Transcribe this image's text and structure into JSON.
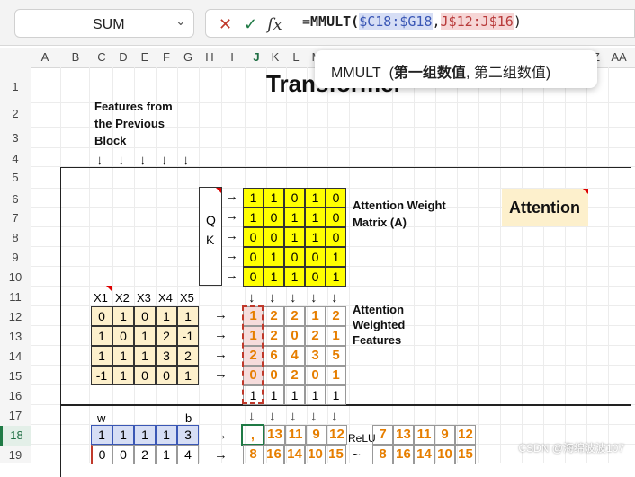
{
  "formula_bar": {
    "name_box": "SUM",
    "cancel_glyph": "✕",
    "enter_glyph": "✓",
    "fx_glyph": "fx",
    "formula_prefix": "=",
    "formula_func": "MMULT(",
    "ref1": "$C18:$G18",
    "comma": ",",
    "ref2": "J$12:J$16",
    "formula_close": ")"
  },
  "tooltip": {
    "func": "MMULT",
    "arg1": "第一组数值",
    "arg2": "第二组数值"
  },
  "columns": [
    "A",
    "B",
    "C",
    "D",
    "E",
    "F",
    "G",
    "H",
    "I",
    "J",
    "K",
    "L",
    "M",
    "N",
    "O",
    "P",
    "Q",
    "R",
    "S",
    "T",
    "U",
    "V",
    "W",
    "X",
    "Y",
    "Z",
    "AA"
  ],
  "rows": [
    "1",
    "2",
    "3",
    "4",
    "5",
    "6",
    "7",
    "8",
    "9",
    "10",
    "11",
    "12",
    "13",
    "14",
    "15",
    "16",
    "17",
    "18",
    "19"
  ],
  "sheet": {
    "title": "Transformer",
    "features_label": [
      "Features from",
      "the Previous",
      "Block"
    ],
    "attention_weight_label": [
      "Attention Weight",
      "Matrix (A)"
    ],
    "attention_badge": "Attention",
    "qk_labels": [
      "Q",
      "K"
    ],
    "x_headers": [
      "X1",
      "X2",
      "X3",
      "X4",
      "X5"
    ],
    "x_matrix": [
      [
        "0",
        "1",
        "0",
        "1",
        "1"
      ],
      [
        "1",
        "0",
        "1",
        "2",
        "-1"
      ],
      [
        "1",
        "1",
        "1",
        "3",
        "2"
      ],
      [
        "-1",
        "1",
        "0",
        "0",
        "1"
      ]
    ],
    "a_matrix": [
      [
        "1",
        "1",
        "0",
        "1",
        "0"
      ],
      [
        "1",
        "0",
        "1",
        "1",
        "0"
      ],
      [
        "0",
        "0",
        "1",
        "1",
        "0"
      ],
      [
        "0",
        "1",
        "0",
        "0",
        "1"
      ],
      [
        "0",
        "1",
        "1",
        "0",
        "1"
      ]
    ],
    "attn_weighted_label": [
      "Attention",
      "Weighted",
      "Features"
    ],
    "weighted_matrix": [
      [
        "1",
        "2",
        "2",
        "1",
        "2"
      ],
      [
        "1",
        "2",
        "0",
        "2",
        "1"
      ],
      [
        "2",
        "6",
        "4",
        "3",
        "5"
      ],
      [
        "0",
        "0",
        "2",
        "0",
        "1"
      ]
    ],
    "ones_row": [
      "1",
      "1",
      "1",
      "1",
      "1"
    ],
    "wb_labels": [
      "w",
      "b"
    ],
    "w_row": [
      "1",
      "1",
      "1",
      "1",
      "3"
    ],
    "editing_cell": ",",
    "r18_values": [
      "13",
      "11",
      "9",
      "12"
    ],
    "relu_label": "ReLU",
    "relu_row18": [
      "7",
      "13",
      "11",
      "9",
      "12"
    ],
    "r19_left": [
      "0",
      "0",
      "2",
      "1",
      "4"
    ],
    "r19_mid": [
      "8",
      "16",
      "14",
      "10",
      "15"
    ],
    "r19_right": [
      "8",
      "16",
      "14",
      "10",
      "15"
    ],
    "arrow_right": "→",
    "arrow_down": "↓",
    "wavy": "~",
    "watermark": "CSDN @海绵波波107"
  }
}
